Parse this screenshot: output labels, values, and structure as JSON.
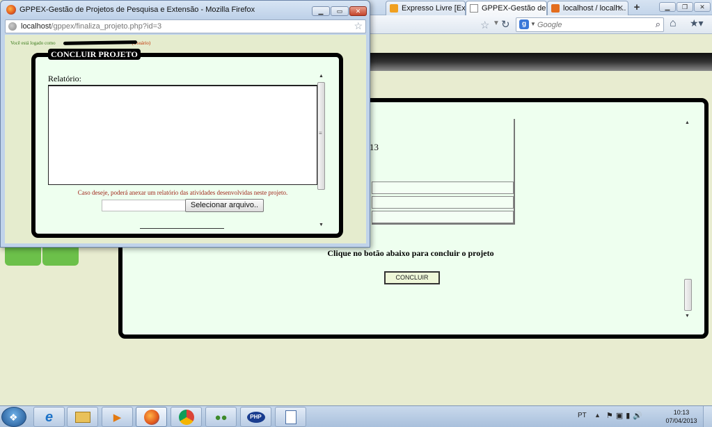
{
  "background_window": {
    "tabs": [
      {
        "label": "Expresso Livre [Ex...",
        "icon": "expresso-icon"
      },
      {
        "label": "GPPEX-Gestão de ...",
        "icon": "page-icon",
        "active": true
      },
      {
        "label": "localhost / localh...",
        "icon": "phpmyadmin-icon"
      }
    ],
    "new_tab_label": "+",
    "search_placeholder": "Google",
    "page": {
      "partial_value": "13",
      "instruction": "Clique no botão abaixo para concluir o projeto",
      "concluir_button": "CONCLUIR"
    }
  },
  "popup": {
    "title": "GPPEX-Gestão de Projetos de Pesquisa e Extensão - Mozilla Firefox",
    "url_host": "localhost",
    "url_path": "/gppex/finaliza_projeto.php?id=3",
    "logged_prefix": "Você está logado como ",
    "logged_suffix": "(Usuário)",
    "frame_title": "CONCLUIR PROJETO",
    "relatorio_label": "Relatório:",
    "relatorio_value": "",
    "hint": "Caso deseje, poderá anexar um relatório das atividades desenvolvidas neste projeto.",
    "file_button": "Selecionar arquivo..",
    "file_value": ""
  },
  "taskbar": {
    "language": "PT",
    "time": "10:13",
    "date": "07/04/2013",
    "apps": [
      {
        "name": "ie-icon",
        "glyph": "e"
      },
      {
        "name": "explorer-icon",
        "glyph": "📁"
      },
      {
        "name": "media-player-icon",
        "glyph": "▶"
      },
      {
        "name": "firefox-icon",
        "glyph": "◉"
      },
      {
        "name": "chrome-icon",
        "glyph": "◎"
      },
      {
        "name": "messenger-icon",
        "glyph": "👥"
      },
      {
        "name": "php-icon",
        "glyph": "PHP"
      },
      {
        "name": "document-icon",
        "glyph": "📄"
      }
    ]
  },
  "colors": {
    "page_bg": "#e7ecd0",
    "panel_bg": "#eeffef",
    "logo_red": "#d40000",
    "logo_green": "#6cc04a",
    "hint_red": "#a0261b"
  }
}
